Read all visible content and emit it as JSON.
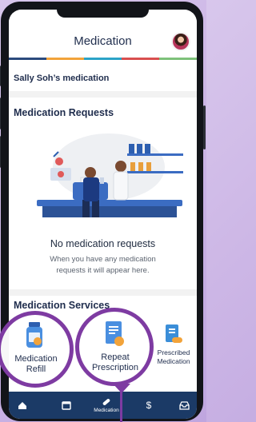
{
  "header": {
    "title": "Medication"
  },
  "colorbar": [
    "#2b4a7d",
    "#f2a33a",
    "#2ba3c7",
    "#d94f4f",
    "#7ec17a"
  ],
  "owner_label": "Sally Soh’s medication",
  "requests": {
    "section_title": "Medication Requests",
    "empty_title": "No medication requests",
    "empty_line1": "When you have any medication",
    "empty_line2": "requests it will appear here."
  },
  "services": {
    "section_title": "Medication Services",
    "items": [
      {
        "line1": "Medication",
        "line2": "Refill",
        "icon": "medicine-bottle-icon"
      },
      {
        "line1": "Repeat",
        "line2": "Prescription",
        "icon": "prescription-document-icon"
      },
      {
        "line1": "Prescribed",
        "line2": "Medication",
        "icon": "prescribed-medication-icon"
      }
    ]
  },
  "nav": {
    "items": [
      {
        "icon": "home-icon",
        "label": ""
      },
      {
        "icon": "calendar-icon",
        "label": ""
      },
      {
        "icon": "pill-icon",
        "label": "Medication"
      },
      {
        "icon": "dollar-icon",
        "label": ""
      },
      {
        "icon": "inbox-icon",
        "label": ""
      }
    ]
  },
  "colors": {
    "accent": "#7e3ba2",
    "nav_bg": "#1b3a66",
    "text_dark": "#1f2d4d"
  }
}
